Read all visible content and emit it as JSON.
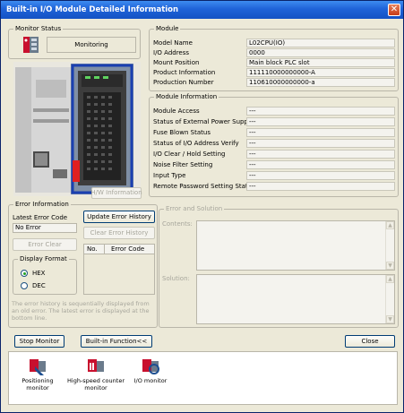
{
  "window": {
    "title": "Built-in I/O Module Detailed Information",
    "close_glyph": "✕"
  },
  "monitor_status": {
    "legend": "Monitor Status",
    "value": "Monitoring"
  },
  "module": {
    "legend": "Module",
    "rows": [
      {
        "label": "Model Name",
        "value": "L02CPU(IO)"
      },
      {
        "label": "I/O Address",
        "value": "0000"
      },
      {
        "label": "Mount Position",
        "value": "Main block PLC slot"
      },
      {
        "label": "Product Information",
        "value": "111110000000000-A"
      },
      {
        "label": "Production Number",
        "value": "110610000000000-a"
      }
    ]
  },
  "module_information": {
    "legend": "Module Information",
    "rows": [
      {
        "label": "Module Access",
        "value": "---"
      },
      {
        "label": "Status of External Power Supply",
        "value": "---"
      },
      {
        "label": "Fuse Blown Status",
        "value": "---"
      },
      {
        "label": "Status of I/O Address Verify",
        "value": "---"
      },
      {
        "label": "I/O Clear / Hold Setting",
        "value": "---"
      },
      {
        "label": "Noise Filter Setting",
        "value": "---"
      },
      {
        "label": "Input Type",
        "value": "---"
      },
      {
        "label": "Remote Password Setting Status",
        "value": "---"
      }
    ]
  },
  "hw_information_button": "H/W Information",
  "error_information": {
    "legend": "Error Information",
    "latest_error_label": "Latest Error Code",
    "latest_error_value": "No Error",
    "update_history_button": "Update Error History",
    "clear_history_button": "Clear Error History",
    "error_clear_button": "Error Clear",
    "history_columns": [
      "No.",
      "Error Code"
    ],
    "display_format": {
      "legend": "Display Format",
      "options": [
        "HEX",
        "DEC"
      ],
      "selected": "HEX"
    },
    "note": "The error history is sequentially displayed from an old error. The latest error is displayed at the bottom line."
  },
  "error_and_solution": {
    "legend": "Error and Solution",
    "contents_label": "Contents:",
    "solution_label": "Solution:"
  },
  "buttons": {
    "stop_monitor": "Stop Monitor",
    "builtin_function": "Built-in Function<<",
    "close": "Close"
  },
  "monitors": [
    {
      "label": "Positioning monitor",
      "icon": "positioning-monitor-icon"
    },
    {
      "label": "High-speed counter monitor",
      "icon": "high-speed-counter-icon"
    },
    {
      "label": "I/O monitor",
      "icon": "io-monitor-icon"
    }
  ],
  "colors": {
    "titlebar": "#1f63d8",
    "window_bg": "#ece9d8",
    "close": "#c63c18"
  }
}
